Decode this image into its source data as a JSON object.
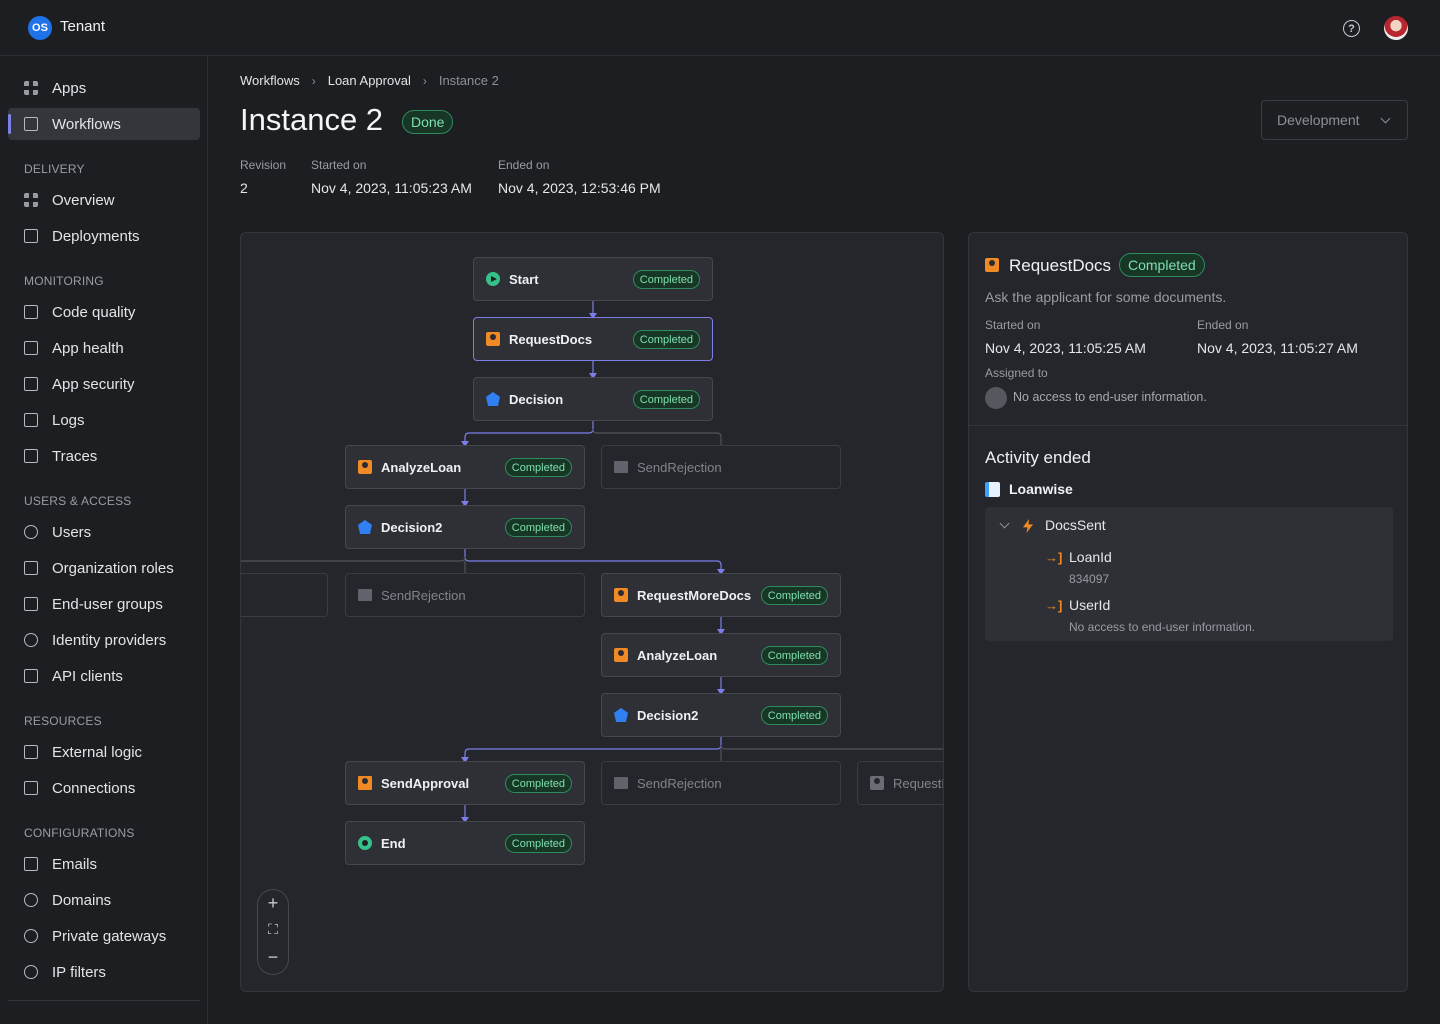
{
  "topbar": {
    "logo_text": "OS",
    "tenant": "Tenant"
  },
  "sidebar": {
    "items_top": [
      {
        "label": "Apps"
      },
      {
        "label": "Workflows"
      }
    ],
    "sections": [
      {
        "title": "DELIVERY",
        "items": [
          {
            "label": "Overview"
          },
          {
            "label": "Deployments"
          }
        ]
      },
      {
        "title": "MONITORING",
        "items": [
          {
            "label": "Code quality"
          },
          {
            "label": "App health"
          },
          {
            "label": "App security"
          },
          {
            "label": "Logs"
          },
          {
            "label": "Traces"
          }
        ]
      },
      {
        "title": "USERS & ACCESS",
        "items": [
          {
            "label": "Users"
          },
          {
            "label": "Organization roles"
          },
          {
            "label": "End-user groups"
          },
          {
            "label": "Identity providers"
          },
          {
            "label": "API clients"
          }
        ]
      },
      {
        "title": "RESOURCES",
        "items": [
          {
            "label": "External logic"
          },
          {
            "label": "Connections"
          }
        ]
      },
      {
        "title": "CONFIGURATIONS",
        "items": [
          {
            "label": "Emails"
          },
          {
            "label": "Domains"
          },
          {
            "label": "Private gateways"
          },
          {
            "label": "IP filters"
          }
        ]
      }
    ]
  },
  "breadcrumb": [
    "Workflows",
    "Loan Approval",
    "Instance 2"
  ],
  "page": {
    "title": "Instance 2",
    "status": "Done",
    "environment": "Development",
    "meta": [
      {
        "label": "Revision",
        "value": "2"
      },
      {
        "label": "Started on",
        "value": "Nov 4, 2023, 11:05:23 AM"
      },
      {
        "label": "Ended on",
        "value": "Nov 4, 2023, 12:53:46 PM"
      }
    ]
  },
  "workflow": {
    "nodes": [
      {
        "label": "Start",
        "icon": "start-icon",
        "status": "Completed"
      },
      {
        "label": "RequestDocs",
        "icon": "human-task-icon",
        "status": "Completed"
      },
      {
        "label": "Decision",
        "icon": "decision-icon",
        "status": "Completed"
      },
      {
        "label": "AnalyzeLoan",
        "icon": "human-task-icon",
        "status": "Completed"
      },
      {
        "label": "SendRejection",
        "icon": "skipped-icon",
        "status": ""
      },
      {
        "label": "Decision2",
        "icon": "decision-icon",
        "status": "Completed"
      },
      {
        "label": "SendRejection",
        "icon": "skipped-icon",
        "status": ""
      },
      {
        "label": "RequestMoreDocs",
        "icon": "human-task-icon",
        "status": "Completed"
      },
      {
        "label": "AnalyzeLoan",
        "icon": "human-task-icon",
        "status": "Completed"
      },
      {
        "label": "Decision2",
        "icon": "decision-icon",
        "status": "Completed"
      },
      {
        "label": "SendApproval",
        "icon": "human-task-icon",
        "status": "Completed"
      },
      {
        "label": "SendRejection",
        "icon": "skipped-icon",
        "status": ""
      },
      {
        "label": "RequestI",
        "icon": "human-task-icon",
        "status": ""
      },
      {
        "label": "End",
        "icon": "end-icon",
        "status": "Completed"
      }
    ],
    "zoom": {
      "in": "+",
      "fit": "⛶",
      "out": "−"
    }
  },
  "details": {
    "title": "RequestDocs",
    "status": "Completed",
    "description": "Ask the applicant for some documents.",
    "started_label": "Started on",
    "started_value": "Nov 4, 2023, 11:05:25 AM",
    "ended_label": "Ended on",
    "ended_value": "Nov 4, 2023, 11:05:27 AM",
    "assigned_label": "Assigned to",
    "assigned_value": "No access to end-user information.",
    "activity_title": "Activity ended",
    "app_name": "Loanwise",
    "event": {
      "name": "DocsSent",
      "params": [
        {
          "name": "LoanId",
          "value": "834097"
        },
        {
          "name": "UserId",
          "value": "No access to end-user information."
        }
      ]
    }
  },
  "colors": {
    "accent": "#7b7fe6",
    "success": "#7ee0ad",
    "human_task": "#f08a24",
    "decision": "#2f80f0",
    "logo": "#1f72e8"
  }
}
